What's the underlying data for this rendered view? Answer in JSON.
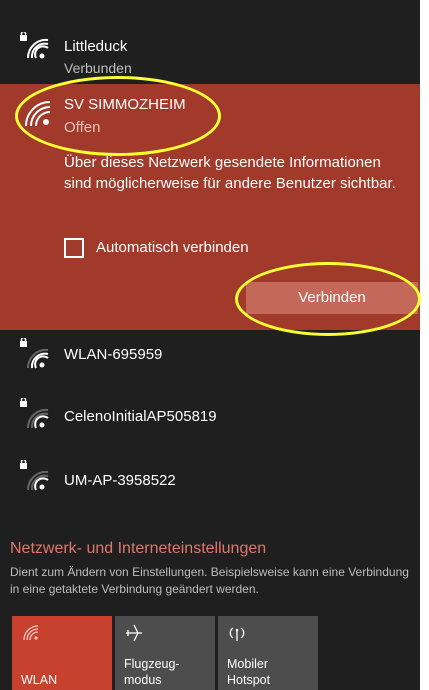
{
  "networks": [
    {
      "name": "Littleduck",
      "status": "Verbunden",
      "secured": true
    },
    {
      "name": "SV SIMMOZHEIM",
      "status": "Offen",
      "secured": false
    },
    {
      "name": "WLAN-695959",
      "status": "",
      "secured": true
    },
    {
      "name": "CelenoInitialAP505819",
      "status": "",
      "secured": true
    },
    {
      "name": "UM-AP-3958522",
      "status": "",
      "secured": true
    }
  ],
  "expanded": {
    "warning": "Über dieses Netzwerk gesendete Informationen sind möglicherweise für andere Benutzer sichtbar.",
    "auto_connect_label": "Automatisch verbinden",
    "connect_label": "Verbinden"
  },
  "settings": {
    "title": "Netzwerk- und Interneteinstellungen",
    "description": "Dient zum Ändern von Einstellungen. Beispielsweise kann eine Verbindung in eine getaktete Verbindung geändert werden."
  },
  "tiles": [
    {
      "label": "WLAN",
      "icon": "wifi-icon",
      "active": true
    },
    {
      "label": "Flugzeug-\nmodus",
      "icon": "airplane-icon",
      "active": false
    },
    {
      "label": "Mobiler\nHotspot",
      "icon": "hotspot-icon",
      "active": false
    }
  ],
  "colors": {
    "accent": "#a23a2b",
    "annotation": "#ffff33",
    "link": "#e0776a"
  }
}
